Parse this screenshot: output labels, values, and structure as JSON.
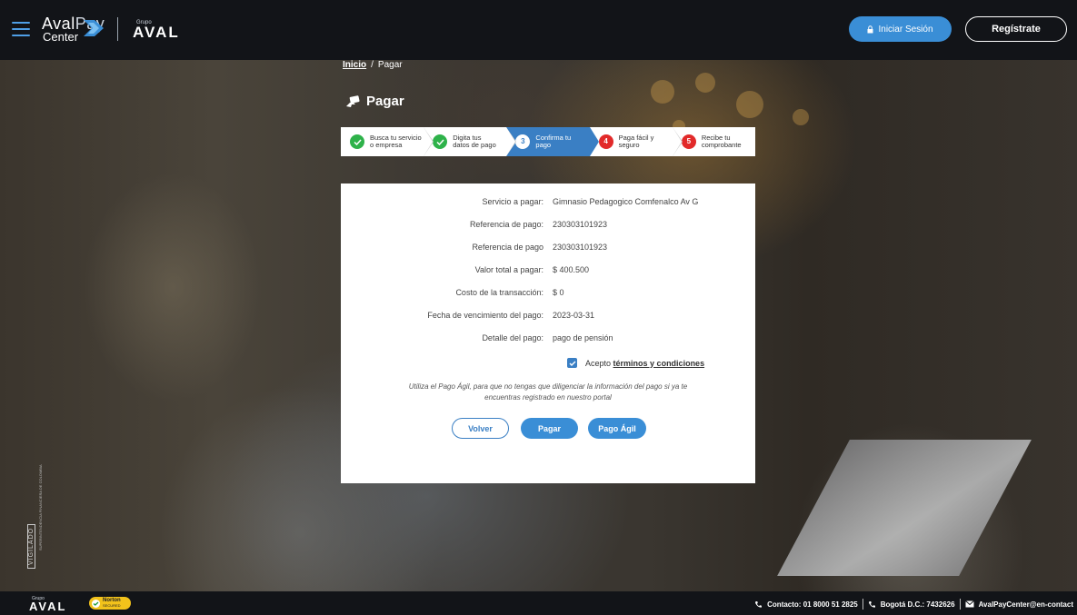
{
  "header": {
    "brand": {
      "aval": "Aval",
      "pay": "Pay",
      "center": "Center"
    },
    "group_logo": {
      "grupo": "Grupo",
      "name": "AVAL"
    },
    "login_label": "Iniciar Sesión",
    "register_label": "Regístrate"
  },
  "breadcrumb": {
    "home": "Inicio",
    "separator": "/",
    "current": "Pagar"
  },
  "page_title": "Pagar",
  "stepper": [
    {
      "badge": "",
      "label_1": "Busca tu servicio",
      "label_2": "o empresa",
      "state": "done"
    },
    {
      "badge": "",
      "label_1": "Digita tus",
      "label_2": "datos de pago",
      "state": "done"
    },
    {
      "badge": "3",
      "label_1": "Confirma tu",
      "label_2": "pago",
      "state": "current"
    },
    {
      "badge": "4",
      "label_1": "Paga fácil y",
      "label_2": "seguro",
      "state": "todo"
    },
    {
      "badge": "5",
      "label_1": "Recibe tu",
      "label_2": "comprobante",
      "state": "todo"
    }
  ],
  "summary": [
    {
      "label": "Servicio a pagar:",
      "value": "Gimnasio Pedagogico Comfenalco Av G"
    },
    {
      "label": "Referencia de pago:",
      "value": "230303101923"
    },
    {
      "label": "Referencia de pago",
      "value": "230303101923"
    },
    {
      "label": "Valor total a pagar:",
      "value": "$ 400.500"
    },
    {
      "label": "Costo de la transacción:",
      "value": "$ 0"
    },
    {
      "label": "Fecha de vencimiento del pago:",
      "value": "2023-03-31"
    },
    {
      "label": "Detalle del pago:",
      "value": "pago de pensión"
    }
  ],
  "terms": {
    "prefix": "Acepto",
    "link": "términos y condiciones",
    "checked": true
  },
  "note": "Utiliza el Pago Ágil, para que no tengas que diligenciar la información del pago si ya te encuentras registrado en nuestro portal",
  "buttons": {
    "back": "Volver",
    "pay": "Pagar",
    "quick": "Pago Ágil"
  },
  "side_badge": {
    "vigilado": "VIGILADO",
    "entity": "SUPERINTENDENCIA FINANCIERA DE COLOMBIA"
  },
  "footer": {
    "group_logo": {
      "grupo": "Grupo",
      "name": "AVAL"
    },
    "norton": {
      "line1": "Norton",
      "line2": "SECURED"
    },
    "contact": "Contacto: 01 8000 51 2825",
    "bogota": "Bogotá D.C.: 7432626",
    "email": "AvalPayCenter@en-contact"
  },
  "colors": {
    "accent": "#3a8ed6",
    "step_active": "#3a7fc4",
    "done": "#2eb24a",
    "todo": "#e22a2a",
    "bar": "#121418"
  }
}
